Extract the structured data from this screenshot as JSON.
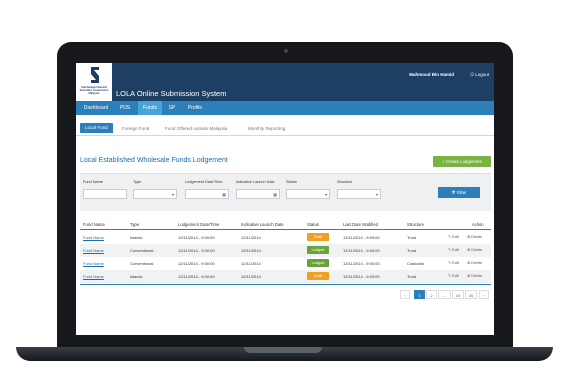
{
  "header": {
    "logo_text": "Suruhanjaya Sekuriti Securities Commission Malaysia",
    "app_title": "LOLA Online Submission System",
    "user_name": "Mahmoud Bin Hamid",
    "logout_label": "Logout"
  },
  "nav": {
    "items": [
      {
        "label": "Dashboard"
      },
      {
        "label": "PDS"
      },
      {
        "label": "Funds"
      },
      {
        "label": "SP"
      },
      {
        "label": "Profile"
      }
    ],
    "active": "Funds"
  },
  "subtabs": [
    {
      "label": "Local Fund"
    },
    {
      "label": "Foreign Fund"
    },
    {
      "label": "Fund Offered outside Malaysia"
    },
    {
      "label": "Monthly Reporting"
    }
  ],
  "page": {
    "title": "Local Established Wholesale Funds Lodgement",
    "create_label": "Create Lodgement"
  },
  "filters": {
    "fund_name_label": "Fund Name",
    "type_label": "Type",
    "lodgement_date_label": "Lodgement Date/Time",
    "launch_date_label": "Indicative Launch Date",
    "status_label": "Status",
    "structure_label": "Structure",
    "filter_label": "Filter"
  },
  "table": {
    "columns": [
      "Fund Name",
      "Type",
      "Lodgement Date/Time",
      "Indicative Launch Date",
      "Status",
      "Last Date Modified",
      "Structure",
      "Action"
    ],
    "rows": [
      {
        "fund": "Fund Name",
        "type": "Islamic",
        "lodgement": "12/11/2014 - 9:00:00",
        "launch": "12/11/2014",
        "status": "Draft",
        "modified": "12/11/2014 - 9:00:00",
        "structure": "Trust"
      },
      {
        "fund": "Fund Name",
        "type": "Conventional",
        "lodgement": "12/11/2014 - 9:00:00",
        "launch": "12/11/2014",
        "status": "Lodged",
        "modified": "12/11/2014 - 9:00:00",
        "structure": "Trust"
      },
      {
        "fund": "Fund Name",
        "type": "Conventional",
        "lodgement": "12/11/2014 - 9:00:00",
        "launch": "12/11/2014",
        "status": "Lodged",
        "modified": "12/11/2014 - 9:00:00",
        "structure": "Custodial"
      },
      {
        "fund": "Fund Name",
        "type": "Islamic",
        "lodgement": "12/11/2014 - 9:00:00",
        "launch": "12/11/2014",
        "status": "Draft",
        "modified": "12/11/2014 - 9:00:00",
        "structure": "Trust"
      }
    ],
    "edit_label": "Edit",
    "delete_label": "Delete"
  },
  "pagination": {
    "prev": "‹",
    "pages": [
      "1",
      "2",
      "...",
      "19",
      "20"
    ],
    "next": "›",
    "current": "1"
  },
  "colors": {
    "draft": "#f0a020",
    "lodged": "#6aa13a",
    "primary": "#2c7fb8",
    "header": "#1d3f63"
  }
}
